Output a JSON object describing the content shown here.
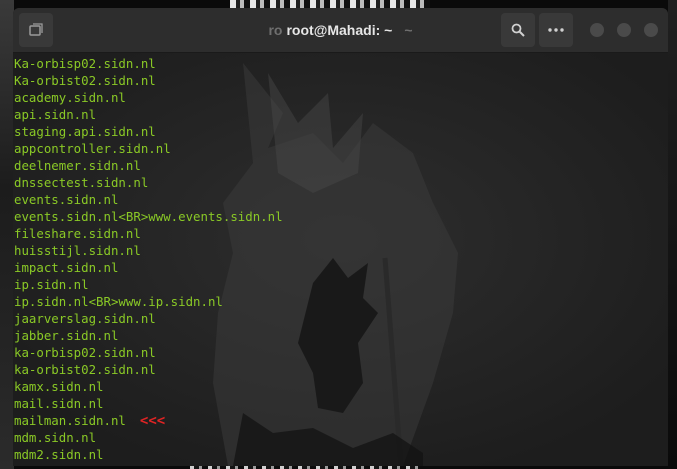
{
  "titlebar": {
    "title_prefix": "ro",
    "title": "root@Mahadi: ~",
    "title_suffix": "~"
  },
  "icons": {
    "new_tab": "new-tab-icon",
    "search": "search-icon",
    "menu": "menu-icon",
    "minimize": "minimize-icon",
    "maximize": "maximize-icon",
    "close": "close-icon"
  },
  "terminal": {
    "lines": [
      "Ka-orbisp02.sidn.nl",
      "Ka-orbist02.sidn.nl",
      "academy.sidn.nl",
      "api.sidn.nl",
      "staging.api.sidn.nl",
      "appcontroller.sidn.nl",
      "deelnemer.sidn.nl",
      "dnssectest.sidn.nl",
      "events.sidn.nl",
      "events.sidn.nl<BR>www.events.sidn.nl",
      "fileshare.sidn.nl",
      "huisstijl.sidn.nl",
      "impact.sidn.nl",
      "ip.sidn.nl",
      "ip.sidn.nl<BR>www.ip.sidn.nl",
      "jaarverslag.sidn.nl",
      "jabber.sidn.nl",
      "ka-orbisp02.sidn.nl",
      "ka-orbist02.sidn.nl",
      "kamx.sidn.nl",
      "mail.sidn.nl",
      "mailman.sidn.nl",
      "mdm.sidn.nl",
      "mdm2.sidn.nl"
    ],
    "marker_text": "<<<",
    "text_color": "#8ac926",
    "marker_color": "#e02424"
  }
}
